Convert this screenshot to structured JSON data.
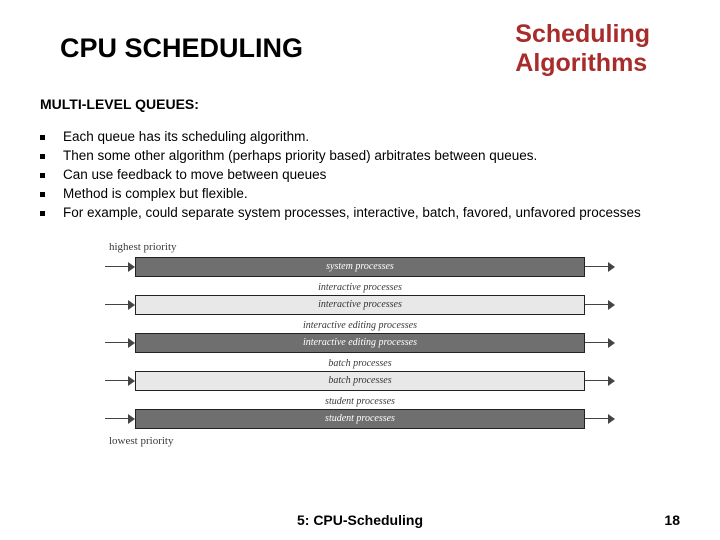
{
  "header": {
    "title_left": "CPU SCHEDULING",
    "title_right_line1": "Scheduling",
    "title_right_line2": "Algorithms"
  },
  "subheading": "MULTI-LEVEL QUEUES:",
  "bullets": [
    "Each queue has its scheduling algorithm.",
    "Then some other algorithm (perhaps priority based) arbitrates between queues.",
    "Can use feedback to move between queues",
    "Method is complex but flexible.",
    "For example, could separate system processes, interactive, batch, favored, unfavored processes"
  ],
  "diagram": {
    "top_label": "highest priority",
    "bottom_label": "lowest priority",
    "queues": [
      {
        "label": "system processes",
        "tone": "dark"
      },
      {
        "label": "interactive processes",
        "tone": "light"
      },
      {
        "label": "interactive editing processes",
        "tone": "dark"
      },
      {
        "label": "batch processes",
        "tone": "light"
      },
      {
        "label": "student processes",
        "tone": "dark"
      }
    ]
  },
  "footer": {
    "center": "5: CPU-Scheduling",
    "page": "18"
  }
}
